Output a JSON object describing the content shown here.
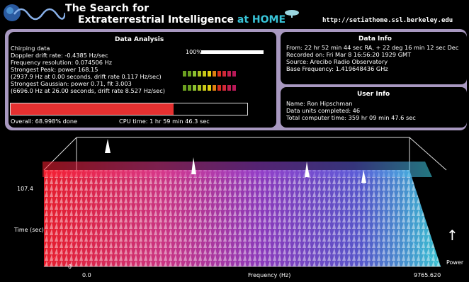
{
  "header": {
    "title_line1": "The Search for",
    "title_line2_a": "Extraterrestrial Intelligence ",
    "title_line2_b": "at HOME",
    "url": "http://setiathome.ssl.berkeley.edu",
    "logo_icon": "wave-logo-icon",
    "dish_icon": "satellite-dish-icon"
  },
  "data_analysis": {
    "title": "Data Analysis",
    "lines": [
      "Chirping data",
      "Doppler drift rate: -0.4385 Hz/sec",
      "Frequency resolution: 0.074506 Hz",
      "Strongest Peak: power 168.15",
      "(2937.9 Hz at  0.00 seconds, drift rate 0.117 Hz/sec)",
      "Strongest Gaussian: power  0.71, fit 3.003",
      "(6696.0 Hz at 26.00 seconds, drift rate 8.527 Hz/sec)"
    ],
    "bar_scale_label": "100%",
    "progress_fraction": 0.689978,
    "overall": "Overall: 68.998% done",
    "cpu_time": "CPU time: 1 hr 59 min 46.3 sec",
    "peak_lights": [
      "#6ca020",
      "#6ca020",
      "#8cc030",
      "#a8c020",
      "#c8c818",
      "#e0d010",
      "#e08010",
      "#d83020",
      "#d02838",
      "#c02050",
      "#b81858"
    ],
    "gauss_lights": [
      "#6ca020",
      "#6ca020",
      "#8cc030",
      "#a8c020",
      "#c8c818",
      "#e0d010",
      "#e08010",
      "#d83020",
      "#d02838",
      "#c02050",
      "#b81858"
    ]
  },
  "data_info": {
    "title": "Data Info",
    "lines": [
      "From: 22 hr 52 min 44 sec RA, + 22 deg 16 min 12 sec Dec",
      "Recorded on: Fri Mar  8 16:56:20 1929 GMT",
      "Source: Arecibo Radio Observatory",
      "Base Frequency: 1.419648436 GHz"
    ]
  },
  "user_info": {
    "title": "User Info",
    "lines": [
      "Name: Ron Hipschman",
      "Data units completed: 46",
      "Total computer time: 359 hr 09 min 47.6 sec"
    ]
  },
  "plot": {
    "y_top": "107.4",
    "y_bottom": "0",
    "y_label": "Time (sec)",
    "x_left": "0.0",
    "x_right": "9765.620",
    "x_label": "Frequency (Hz)",
    "z_label": "Power",
    "colors": {
      "low": "#ff2030",
      "mid": "#c040c0",
      "high": "#6060e0",
      "end": "#40d8e8"
    }
  }
}
